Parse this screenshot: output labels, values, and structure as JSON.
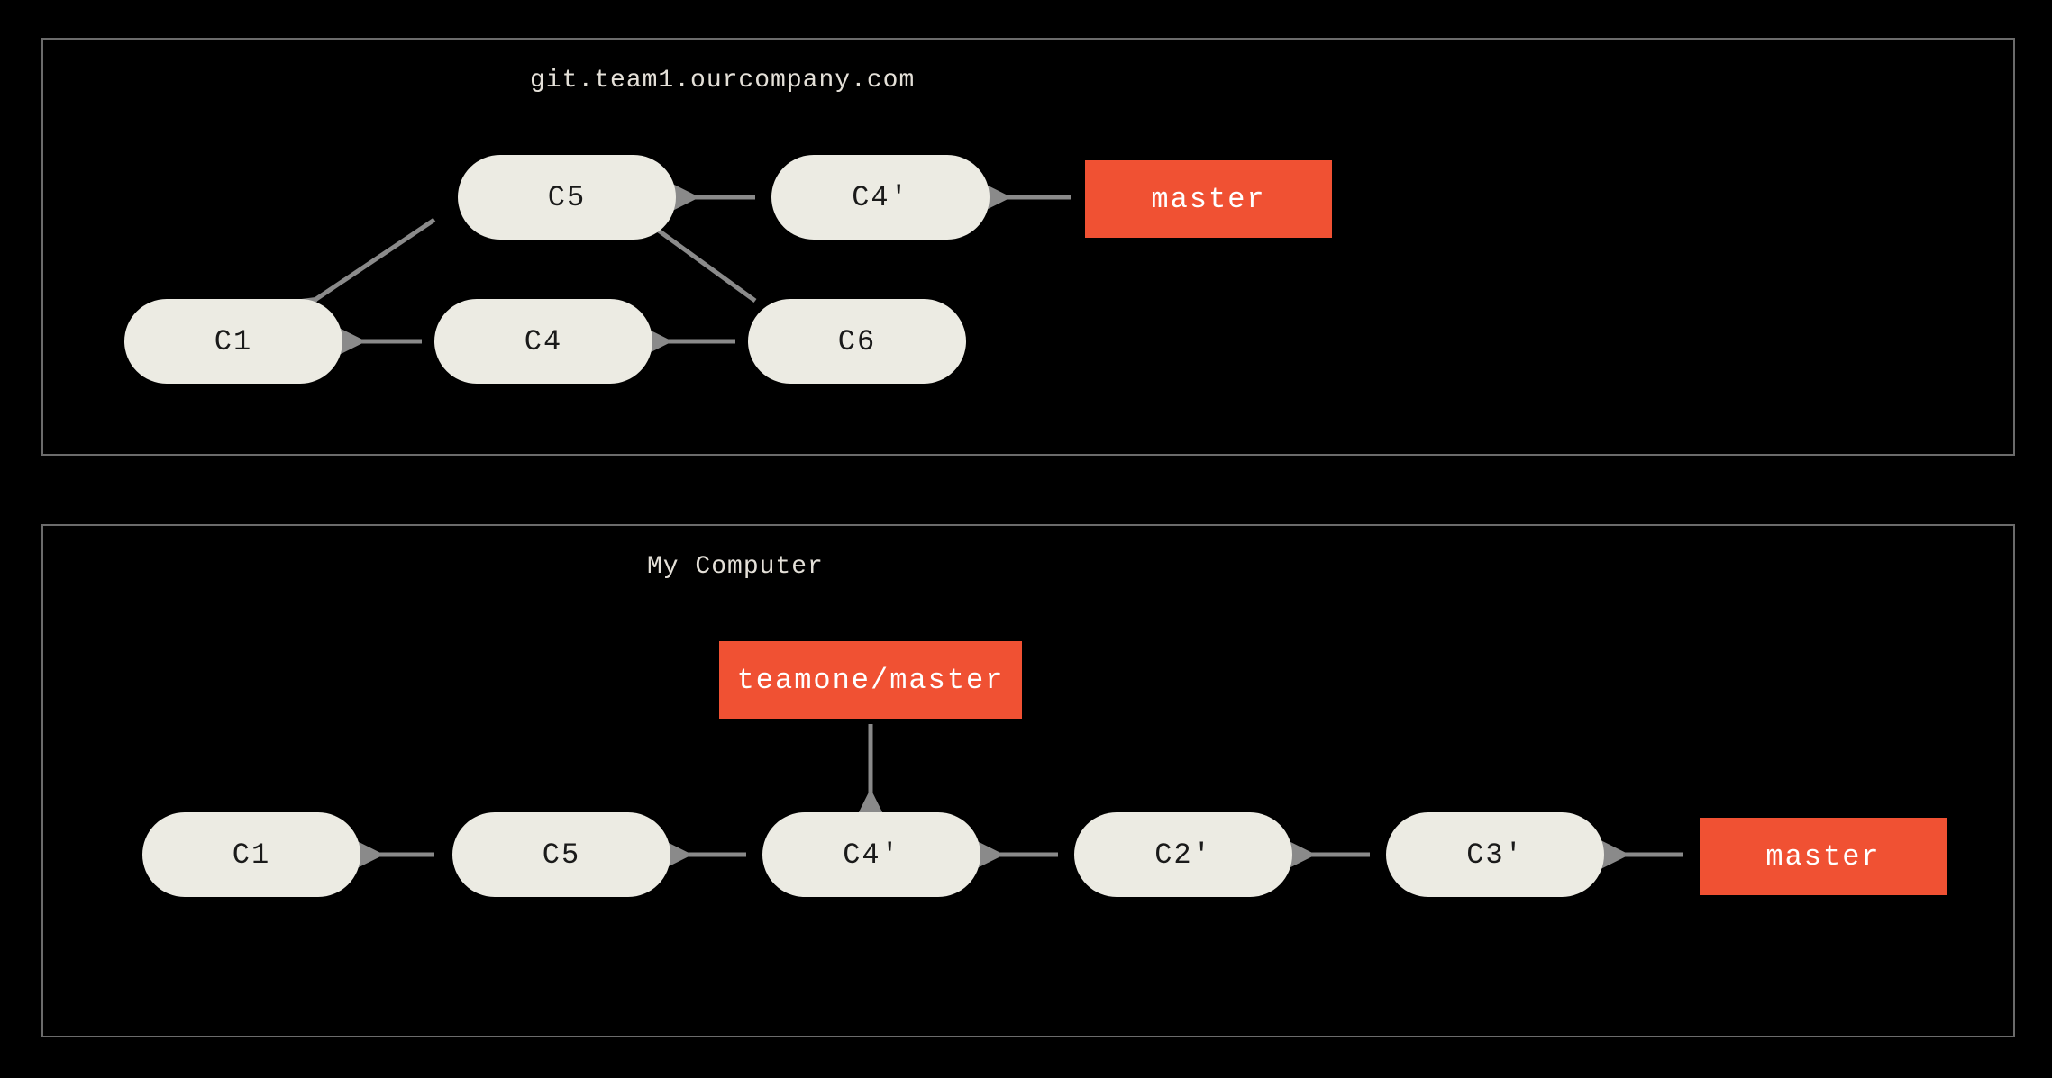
{
  "colors": {
    "background": "#000000",
    "panel_border": "#6b6b6b",
    "commit_fill": "#ecebe3",
    "commit_text": "#1a1a1a",
    "branch_fill": "#f05133",
    "branch_text": "#ffffff",
    "arrow": "#8a8a8a"
  },
  "remote": {
    "title": "git.team1.ourcompany.com",
    "commits": {
      "c1": "C1",
      "c4": "C4",
      "c5": "C5",
      "c6": "C6",
      "c4p": "C4'"
    },
    "branches": {
      "master": "master"
    },
    "edges": [
      {
        "from": "c5",
        "to": "c1"
      },
      {
        "from": "c4",
        "to": "c1"
      },
      {
        "from": "c6",
        "to": "c4"
      },
      {
        "from": "c6",
        "to": "c5"
      },
      {
        "from": "c4p",
        "to": "c5"
      },
      {
        "from": "master",
        "to": "c4p"
      }
    ]
  },
  "local": {
    "title": "My Computer",
    "commits": {
      "c1": "C1",
      "c5": "C5",
      "c4p": "C4'",
      "c2p": "C2'",
      "c3p": "C3'"
    },
    "branches": {
      "teamone_master": "teamone/master",
      "master": "master"
    },
    "edges": [
      {
        "from": "c5",
        "to": "c1"
      },
      {
        "from": "c4p",
        "to": "c5"
      },
      {
        "from": "c2p",
        "to": "c4p"
      },
      {
        "from": "c3p",
        "to": "c2p"
      },
      {
        "from": "master",
        "to": "c3p"
      },
      {
        "from": "teamone_master",
        "to": "c4p"
      }
    ]
  }
}
